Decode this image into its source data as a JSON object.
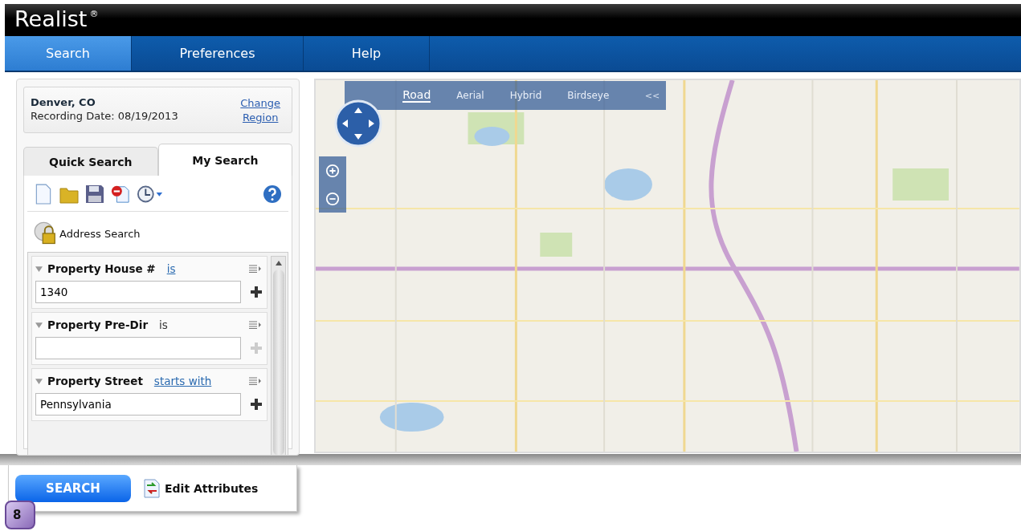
{
  "app": {
    "logo": "Realist",
    "logo_mark": "®"
  },
  "nav_tabs": [
    {
      "label": "Search",
      "selected": true
    },
    {
      "label": "Preferences",
      "selected": false
    },
    {
      "label": "Help",
      "selected": false
    }
  ],
  "region": {
    "city": "Denver, CO",
    "recording_date": "Recording Date: 08/19/2013",
    "change_link": "Change Region"
  },
  "search_tabs": [
    {
      "label": "Quick Search",
      "selected": false
    },
    {
      "label": "My Search",
      "selected": true
    }
  ],
  "address_search": {
    "label": "Address Search"
  },
  "criteria": [
    {
      "label": "Property House #",
      "operator": "is",
      "operator_link": true,
      "value": "1340",
      "add_enabled": true
    },
    {
      "label": "Property Pre-Dir",
      "operator": "is",
      "operator_link": false,
      "add_enabled": false
    },
    {
      "label": "Property Street",
      "operator": "starts with",
      "operator_link": true,
      "value": "Pennsylvania",
      "add_enabled": true
    }
  ],
  "map": {
    "view_options": [
      {
        "label": "Road",
        "selected": true
      },
      {
        "label": "Aerial",
        "selected": false
      },
      {
        "label": "Hybrid",
        "selected": false
      },
      {
        "label": "Birdseye",
        "selected": false
      }
    ],
    "collapse": "<<"
  },
  "actions": {
    "search": "SEARCH",
    "edit_attributes": "Edit Attributes"
  },
  "step_badge": "8"
}
